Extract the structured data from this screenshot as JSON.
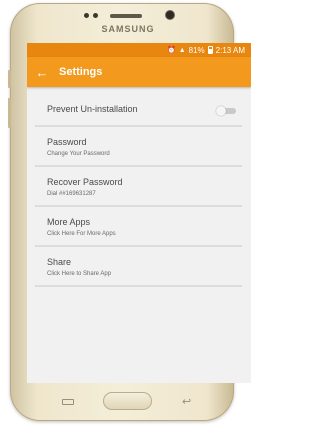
{
  "device": {
    "brand": "SAMSUNG"
  },
  "status_bar": {
    "battery": "81%",
    "time": "2:13 AM",
    "icons": [
      "alarm-icon",
      "signal-icon",
      "battery-icon"
    ]
  },
  "app_bar": {
    "title": "Settings",
    "back_icon": "arrow-left-icon",
    "color": "#f39a1e"
  },
  "settings": {
    "prevent_uninstall": {
      "label": "Prevent Un-installation",
      "enabled": false
    },
    "items": [
      {
        "label": "Password",
        "subtitle": "Change Your Password"
      },
      {
        "label": "Recover Password",
        "subtitle": "Dial ##169631287"
      },
      {
        "label": "More Apps",
        "subtitle": "Click Here For More Apps"
      },
      {
        "label": "Share",
        "subtitle": "Click Here to Share App"
      }
    ]
  }
}
